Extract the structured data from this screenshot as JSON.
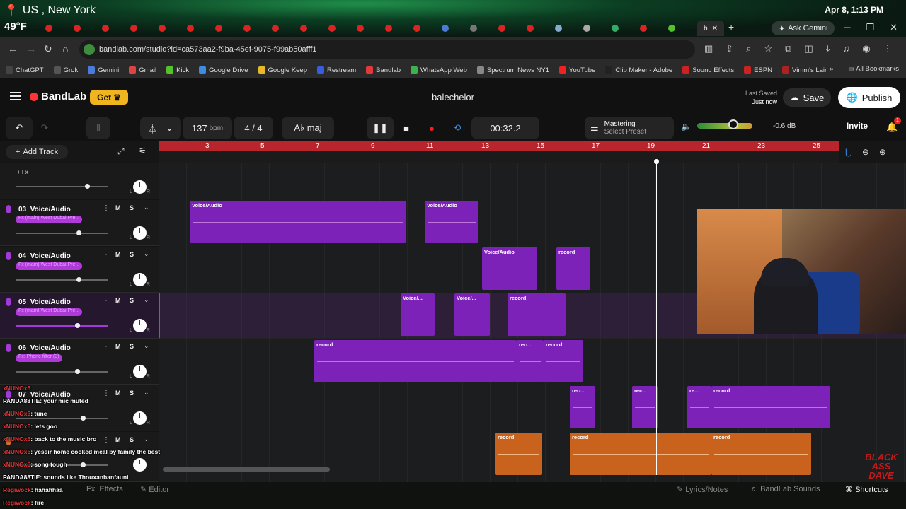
{
  "overlay": {
    "location": "US , New York",
    "temperature": "49°F",
    "datetime": "Apr 8, 1:13 PM"
  },
  "browser": {
    "active_tab_label": "b",
    "ask_gemini": "Ask Gemini",
    "url": "bandlab.com/studio?id=ca573aa2-f9ba-45ef-9075-f99ab50afff1",
    "bookmarks": [
      "ChatGPT",
      "Grok",
      "Gemini",
      "Gmail",
      "Kick",
      "Google Drive",
      "Google Keep",
      "Restream",
      "Bandlab",
      "WhatsApp Web",
      "Spectrum News NY1",
      "YouTube",
      "Clip Maker - Adobe",
      "Sound Effects",
      "ESPN",
      "Vimm's Lair"
    ],
    "bookmark_colors": [
      "#444",
      "#333",
      "#4a7bd8",
      "#d44",
      "#53c22b",
      "#3a8de0",
      "#e6b82a",
      "#3a5de0",
      "#e23a3a",
      "#3bb34a",
      "#666",
      "#e22",
      "#222",
      "#c22",
      "#c22",
      "#a22"
    ],
    "all_bookmarks": "All Bookmarks"
  },
  "header": {
    "brand": "BandLab",
    "get_label": "Get",
    "project_title": "balechelor",
    "last_saved_label": "Last Saved",
    "last_saved_value": "Just now",
    "save_label": "Save",
    "publish_label": "Publish"
  },
  "transport": {
    "bpm": "137",
    "bpm_unit": "bpm",
    "time_signature": "4 / 4",
    "key": "A♭ maj",
    "time": "00:32.2",
    "mastering_label": "Mastering",
    "mastering_preset": "Select Preset",
    "master_level_db": "-0.6 dB",
    "invite_label": "Invite",
    "notification_count": "1"
  },
  "tracklist": {
    "add_track_label": "Add Track",
    "fx_label": "+ Fx",
    "mute": "M",
    "solo": "S",
    "tracks": [
      {
        "num": "03",
        "name": "Voice/Audio",
        "fx": "Fx (main) West Dubai Pre..."
      },
      {
        "num": "04",
        "name": "Voice/Audio",
        "fx": "Fx (main) West Dubai Pre..."
      },
      {
        "num": "05",
        "name": "Voice/Audio",
        "fx": "Fx (main) West Dubai Pre..."
      },
      {
        "num": "06",
        "name": "Voice/Audio",
        "fx": "Fx: Phone filter (3)"
      },
      {
        "num": "07",
        "name": "Voice/Audio",
        "fx": ""
      }
    ]
  },
  "ruler": {
    "bars": [
      "3",
      "5",
      "7",
      "9",
      "11",
      "13",
      "15",
      "17",
      "19",
      "21",
      "23",
      "25"
    ]
  },
  "clips": {
    "voice": "Voice/Audio",
    "voice_short": "Voice/...",
    "record": "record",
    "rec_short": "rec...",
    "re_short": "re..."
  },
  "chat": [
    {
      "user": "xNUNOx6",
      "msg": ""
    },
    {
      "user": "PANDA88TIE",
      "msg": "your mic muted"
    },
    {
      "user": "xNUNOx6",
      "msg": "tune"
    },
    {
      "user": "xNUNOx6",
      "msg": "lets goo"
    },
    {
      "user": "xNUNOx6",
      "msg": "back to the music bro"
    },
    {
      "user": "xNUNOx6",
      "msg": "yessir home cooked meal by family the best"
    },
    {
      "user": "xNUNOx6",
      "msg": "song tough"
    },
    {
      "user": "PANDA88TIE",
      "msg": "sounds like Thouxanbanfauni"
    },
    {
      "user": "Regiwock",
      "msg": "hahahhaa"
    },
    {
      "user": "Regiwock",
      "msg": "fire"
    }
  ],
  "bottom": {
    "effects": "Effects",
    "editor": "Editor",
    "lyrics": "Lyrics/Notes",
    "sounds": "BandLab Sounds",
    "shortcuts": "Shortcuts"
  },
  "watermark": "BLACK ASS DAVE"
}
